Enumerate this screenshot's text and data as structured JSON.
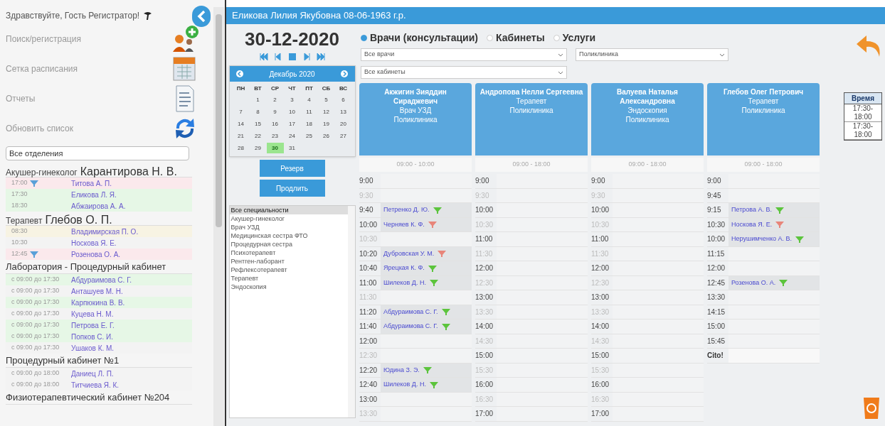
{
  "sidebar": {
    "greeting": "Здравствуйте, Гость Регистратор!",
    "menu": [
      {
        "label": "Поиск/регистрация",
        "kind": "add-user"
      },
      {
        "label": "Сетка расписания",
        "kind": "calendar"
      },
      {
        "label": "Отчеты",
        "kind": "report"
      },
      {
        "label": "Обновить список",
        "kind": "refresh"
      }
    ],
    "department_select": {
      "value": "Все отделения"
    },
    "groups": [
      {
        "role": "Акушер-гинеколог",
        "name": "Карантирова Н. В.",
        "rows": [
          {
            "time": "17:00",
            "patient": "Титова А. П.",
            "flagged": true,
            "color": "#fbe9ec"
          },
          {
            "time": "17:30",
            "patient": "Еликова Л. Я.",
            "flagged": false,
            "color": "#e6f7e6"
          },
          {
            "time": "18:30",
            "patient": "Абжаирова А. А.",
            "flagged": false,
            "color": "#e6f7e6"
          }
        ]
      },
      {
        "role": "Терапевт",
        "name": "Глебов О. П.",
        "rows": [
          {
            "time": "08:30",
            "patient": "Владимирская П. О.",
            "flagged": false,
            "color": "#f7f3e3"
          },
          {
            "time": "10:30",
            "patient": "Носкова Я. Е.",
            "flagged": false,
            "color": "#f3f3f3"
          },
          {
            "time": "12:45",
            "patient": "Розенова О. А.",
            "flagged": true,
            "color": "#fbe9ec"
          }
        ]
      },
      {
        "title": "Лаборатория - Процедурный кабинет",
        "rows": [
          {
            "time": "с 09:00 до 17:30",
            "patient": "Абдураимова С. Г.",
            "flagged": false,
            "color": "#e6f7e6"
          },
          {
            "time": "с 09:00 до 17:30",
            "patient": "Анташуев М. Н.",
            "flagged": false,
            "color": "#f3f3f3"
          },
          {
            "time": "с 09:00 до 17:30",
            "patient": "Карпюкина В. В.",
            "flagged": false,
            "color": "#e6f7e6"
          },
          {
            "time": "с 09:00 до 17:30",
            "patient": "Куцева Н. М.",
            "flagged": false,
            "color": "#f3f3f3"
          },
          {
            "time": "с 09:00 до 17:30",
            "patient": "Петрова Е. Г.",
            "flagged": false,
            "color": "#e6f7e6"
          },
          {
            "time": "с 09:00 до 17:30",
            "patient": "Попков С. И.",
            "flagged": false,
            "color": "#e6f7e6"
          },
          {
            "time": "с 09:00 до 17:30",
            "patient": "Ушаков К. М.",
            "flagged": false,
            "color": "#f3f3f3"
          }
        ]
      },
      {
        "title": "Процедурный кабинет №1",
        "rows": [
          {
            "time": "с 09:00 до 18:00",
            "patient": "Даниец Л. П.",
            "flagged": false,
            "color": "#f3f3f3"
          },
          {
            "time": "с 09:00 до 18:00",
            "patient": "Титчиева Я. К.",
            "flagged": false,
            "color": "#f3f3f3"
          }
        ]
      },
      {
        "title": "Физиотерапевтический кабинет №204"
      }
    ]
  },
  "patient_bar": {
    "title": "Еликова Лилия Якубовна 08-06-1963 г.р."
  },
  "date": "30-12-2020",
  "calendar": {
    "month": "Декабрь 2020",
    "weekdays": [
      "ПН",
      "ВТ",
      "СР",
      "ЧТ",
      "ПТ",
      "СБ",
      "ВС"
    ],
    "weeks": [
      {
        "kind": "first",
        "days": [
          {
            "day": "1",
            "selected": false
          },
          {
            "day": "2",
            "selected": false
          },
          {
            "day": "3",
            "selected": false
          },
          {
            "day": "4",
            "selected": false
          },
          {
            "day": "5",
            "selected": false
          },
          {
            "day": "6",
            "selected": false
          }
        ]
      },
      {
        "kind": "full",
        "days": [
          {
            "day": "7",
            "selected": false
          },
          {
            "day": "8",
            "selected": false
          },
          {
            "day": "9",
            "selected": false
          },
          {
            "day": "10",
            "selected": false
          },
          {
            "day": "11",
            "selected": false
          },
          {
            "day": "12",
            "selected": false
          },
          {
            "day": "13",
            "selected": false
          }
        ]
      },
      {
        "kind": "full",
        "days": [
          {
            "day": "14",
            "selected": false
          },
          {
            "day": "15",
            "selected": false
          },
          {
            "day": "16",
            "selected": false
          },
          {
            "day": "17",
            "selected": false
          },
          {
            "day": "18",
            "selected": false
          },
          {
            "day": "19",
            "selected": false
          },
          {
            "day": "20",
            "selected": false
          }
        ]
      },
      {
        "kind": "full",
        "days": [
          {
            "day": "21",
            "selected": false
          },
          {
            "day": "22",
            "selected": false
          },
          {
            "day": "23",
            "selected": false
          },
          {
            "day": "24",
            "selected": false
          },
          {
            "day": "25",
            "selected": false
          },
          {
            "day": "26",
            "selected": false
          },
          {
            "day": "27",
            "selected": false
          }
        ]
      },
      {
        "kind": "last",
        "days": [
          {
            "day": "28",
            "selected": false
          },
          {
            "day": "29",
            "selected": false
          },
          {
            "day": "30",
            "selected": true
          },
          {
            "day": "31",
            "selected": false
          }
        ]
      }
    ]
  },
  "buttons": [
    "Резерв",
    "Продлить"
  ],
  "specialties": [
    {
      "label": "Все специальности",
      "selected": true
    },
    {
      "label": "Акушер-гинеколог",
      "selected": false
    },
    {
      "label": "Врач УЗД",
      "selected": false
    },
    {
      "label": "Медицинская сестра ФТО",
      "selected": false
    },
    {
      "label": "Процедурная сестра",
      "selected": false
    },
    {
      "label": "Психотерапевт",
      "selected": false
    },
    {
      "label": "Рентген-лаборант",
      "selected": false
    },
    {
      "label": "Рефлексотерапевт",
      "selected": false
    },
    {
      "label": "Терапевт",
      "selected": false
    },
    {
      "label": "Эндоскопия",
      "selected": false
    }
  ],
  "modes": [
    {
      "label": "Врачи (консультации)",
      "selected": true
    },
    {
      "label": "Кабинеты",
      "selected": false
    },
    {
      "label": "Услуги",
      "selected": false
    }
  ],
  "filters": {
    "doctor": "Все врачи",
    "clinic": "Поликлиника",
    "room": "Все кабинеты"
  },
  "doctors": [
    {
      "name": "Акжигин Зияддин Сираджевич",
      "specialty": "Врач УЗД",
      "clinic": "Поликлиника",
      "hours": "09:00 - 10:00",
      "slots": [
        {
          "kind": "free",
          "time": "9:00",
          "dim": false
        },
        {
          "kind": "free",
          "time": "9:30",
          "dim": true
        },
        {
          "kind": "booked",
          "time": "9:40",
          "patient": "Петренко Д. Ю.",
          "color": "#5cc43c"
        },
        {
          "kind": "booked",
          "time": "10:00",
          "patient": "Черняев К. Ф.",
          "color": "#e8857a"
        },
        {
          "kind": "free",
          "time": "10:30",
          "dim": true
        },
        {
          "kind": "booked",
          "time": "10:20",
          "patient": "Дубровская У. М.",
          "color": "#e8857a"
        },
        {
          "kind": "booked",
          "time": "10:40",
          "patient": "Ярецкая К. Ф.",
          "color": "#5cc43c"
        },
        {
          "kind": "booked",
          "time": "11:00",
          "patient": "Шилеков Д. Н.",
          "color": "#5cc43c"
        },
        {
          "kind": "free",
          "time": "11:30",
          "dim": true
        },
        {
          "kind": "booked",
          "time": "11:20",
          "patient": "Абдураимова С. Г.",
          "color": "#5cc43c"
        },
        {
          "kind": "booked",
          "time": "11:40",
          "patient": "Абдураимова С. Г.",
          "color": "#5cc43c"
        },
        {
          "kind": "free",
          "time": "12:00",
          "dim": false
        },
        {
          "kind": "free",
          "time": "12:30",
          "dim": true
        },
        {
          "kind": "booked",
          "time": "12:20",
          "patient": "Юдина З. Э.",
          "color": "#5cc43c"
        },
        {
          "kind": "booked",
          "time": "12:40",
          "patient": "Шилеков Д. Н.",
          "color": "#5cc43c"
        },
        {
          "kind": "free",
          "time": "13:00",
          "dim": false
        },
        {
          "kind": "free",
          "time": "13:30",
          "dim": true
        }
      ]
    },
    {
      "name": "Андропова Нелли Сергеевна",
      "specialty": "Терапевт",
      "clinic": "Поликлиника",
      "hours": "09:00 - 18:00",
      "slots": [
        {
          "kind": "free",
          "time": "9:00",
          "dim": false
        },
        {
          "kind": "free",
          "time": "9:30",
          "dim": true
        },
        {
          "kind": "free",
          "time": "10:00",
          "dim": false
        },
        {
          "kind": "free",
          "time": "10:30",
          "dim": true
        },
        {
          "kind": "free",
          "time": "11:00",
          "dim": false
        },
        {
          "kind": "free",
          "time": "11:30",
          "dim": true
        },
        {
          "kind": "free",
          "time": "12:00",
          "dim": false
        },
        {
          "kind": "free",
          "time": "12:30",
          "dim": true
        },
        {
          "kind": "free",
          "time": "13:00",
          "dim": false
        },
        {
          "kind": "free",
          "time": "13:30",
          "dim": true
        },
        {
          "kind": "free",
          "time": "14:00",
          "dim": false
        },
        {
          "kind": "free",
          "time": "14:30",
          "dim": true
        },
        {
          "kind": "free",
          "time": "15:00",
          "dim": false
        },
        {
          "kind": "free",
          "time": "15:30",
          "dim": true
        },
        {
          "kind": "free",
          "time": "16:00",
          "dim": false
        },
        {
          "kind": "free",
          "time": "16:30",
          "dim": true
        },
        {
          "kind": "free",
          "time": "17:00",
          "dim": false
        }
      ]
    },
    {
      "name": "Валуева Наталья Александровна",
      "specialty": "Эндоскопия",
      "clinic": "Поликлиника",
      "hours": "09:00 - 18:00",
      "slots": [
        {
          "kind": "free",
          "time": "9:00",
          "dim": false
        },
        {
          "kind": "free",
          "time": "9:30",
          "dim": true
        },
        {
          "kind": "free",
          "time": "10:00",
          "dim": false
        },
        {
          "kind": "free",
          "time": "10:30",
          "dim": true
        },
        {
          "kind": "free",
          "time": "11:00",
          "dim": false
        },
        {
          "kind": "free",
          "time": "11:30",
          "dim": true
        },
        {
          "kind": "free",
          "time": "12:00",
          "dim": false
        },
        {
          "kind": "free",
          "time": "12:30",
          "dim": true
        },
        {
          "kind": "free",
          "time": "13:00",
          "dim": false
        },
        {
          "kind": "free",
          "time": "13:30",
          "dim": true
        },
        {
          "kind": "free",
          "time": "14:00",
          "dim": false
        },
        {
          "kind": "free",
          "time": "14:30",
          "dim": true
        },
        {
          "kind": "free",
          "time": "15:00",
          "dim": false
        },
        {
          "kind": "free",
          "time": "15:30",
          "dim": true
        },
        {
          "kind": "free",
          "time": "16:00",
          "dim": false
        },
        {
          "kind": "free",
          "time": "16:30",
          "dim": true
        },
        {
          "kind": "free",
          "time": "17:00",
          "dim": false
        }
      ]
    },
    {
      "name": "Глебов Олег Петрович",
      "specialty": "Терапевт",
      "clinic": "Поликлиника",
      "hours": "09:00 - 18:00",
      "slots": [
        {
          "kind": "free",
          "time": "9:00",
          "dim": false
        },
        {
          "kind": "free",
          "time": "9:45",
          "dim": false
        },
        {
          "kind": "booked",
          "time": "9:15",
          "patient": "Петрова А. В.",
          "color": "#5cc43c"
        },
        {
          "kind": "booked",
          "time": "10:30",
          "patient": "Носкова Я. Е.",
          "color": "#e8857a"
        },
        {
          "kind": "booked",
          "time": "10:00",
          "patient": "Нерушимченко А. В.",
          "color": "#5cc43c"
        },
        {
          "kind": "free",
          "time": "11:15",
          "dim": false
        },
        {
          "kind": "free",
          "time": "12:00",
          "dim": false
        },
        {
          "kind": "booked",
          "time": "12:45",
          "patient": "Розенова О. А.",
          "color": "#5cc43c"
        },
        {
          "kind": "free",
          "time": "13:30",
          "dim": false
        },
        {
          "kind": "free",
          "time": "14:15",
          "dim": false
        },
        {
          "kind": "free",
          "time": "15:00",
          "dim": false
        },
        {
          "kind": "free",
          "time": "15:45",
          "dim": false
        },
        {
          "kind": "cito",
          "time": "Cito!"
        }
      ]
    }
  ],
  "time_table": {
    "header": "Время",
    "rows": [
      "17:30-18:00",
      "17:30-18:00"
    ]
  }
}
